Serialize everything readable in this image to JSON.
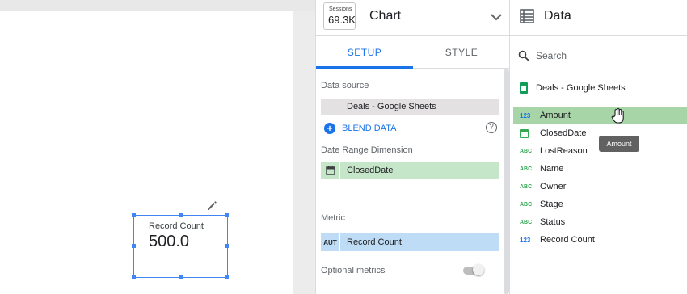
{
  "canvas": {
    "scorecard": {
      "label": "Record Count",
      "value": "500.0"
    }
  },
  "chart_panel": {
    "thumbnail": {
      "label": "Sessions",
      "value": "69.3K"
    },
    "title": "Chart",
    "tabs": [
      {
        "label": "SETUP",
        "active": true
      },
      {
        "label": "STYLE",
        "active": false
      }
    ],
    "setup": {
      "data_source_label": "Data source",
      "data_source_value": "Deals - Google Sheets",
      "blend_label": "BLEND DATA",
      "help_glyph": "?",
      "date_range_label": "Date Range Dimension",
      "date_range_value": "ClosedDate",
      "metric_label": "Metric",
      "metric_type": "AUT",
      "metric_value": "Record Count",
      "optional_metrics_label": "Optional metrics"
    }
  },
  "data_panel": {
    "title": "Data",
    "search_placeholder": "Search",
    "data_source": "Deals - Google Sheets",
    "fields": [
      {
        "type": "123",
        "kind": "num",
        "name": "Amount",
        "highlighted": true
      },
      {
        "type": "",
        "kind": "date",
        "name": "ClosedDate",
        "highlighted": false
      },
      {
        "type": "ABC",
        "kind": "text",
        "name": "LostReason",
        "highlighted": false
      },
      {
        "type": "ABC",
        "kind": "text",
        "name": "Name",
        "highlighted": false
      },
      {
        "type": "ABC",
        "kind": "text",
        "name": "Owner",
        "highlighted": false
      },
      {
        "type": "ABC",
        "kind": "text",
        "name": "Stage",
        "highlighted": false
      },
      {
        "type": "ABC",
        "kind": "text",
        "name": "Status",
        "highlighted": false
      },
      {
        "type": "123",
        "kind": "num",
        "name": "Record Count",
        "highlighted": false
      }
    ],
    "tooltip": "Amount"
  },
  "colors": {
    "accent": "#1a73e8",
    "dimension_green": "#c6e6c9",
    "metric_blue": "#bfdcf7",
    "drag_highlight": "#a8d5a8"
  },
  "icons": [
    "pencil-icon",
    "chevron-down-icon",
    "list-icon",
    "search-icon",
    "sheets-icon",
    "add-icon",
    "help-icon",
    "calendar-icon",
    "hand-cursor-icon"
  ]
}
